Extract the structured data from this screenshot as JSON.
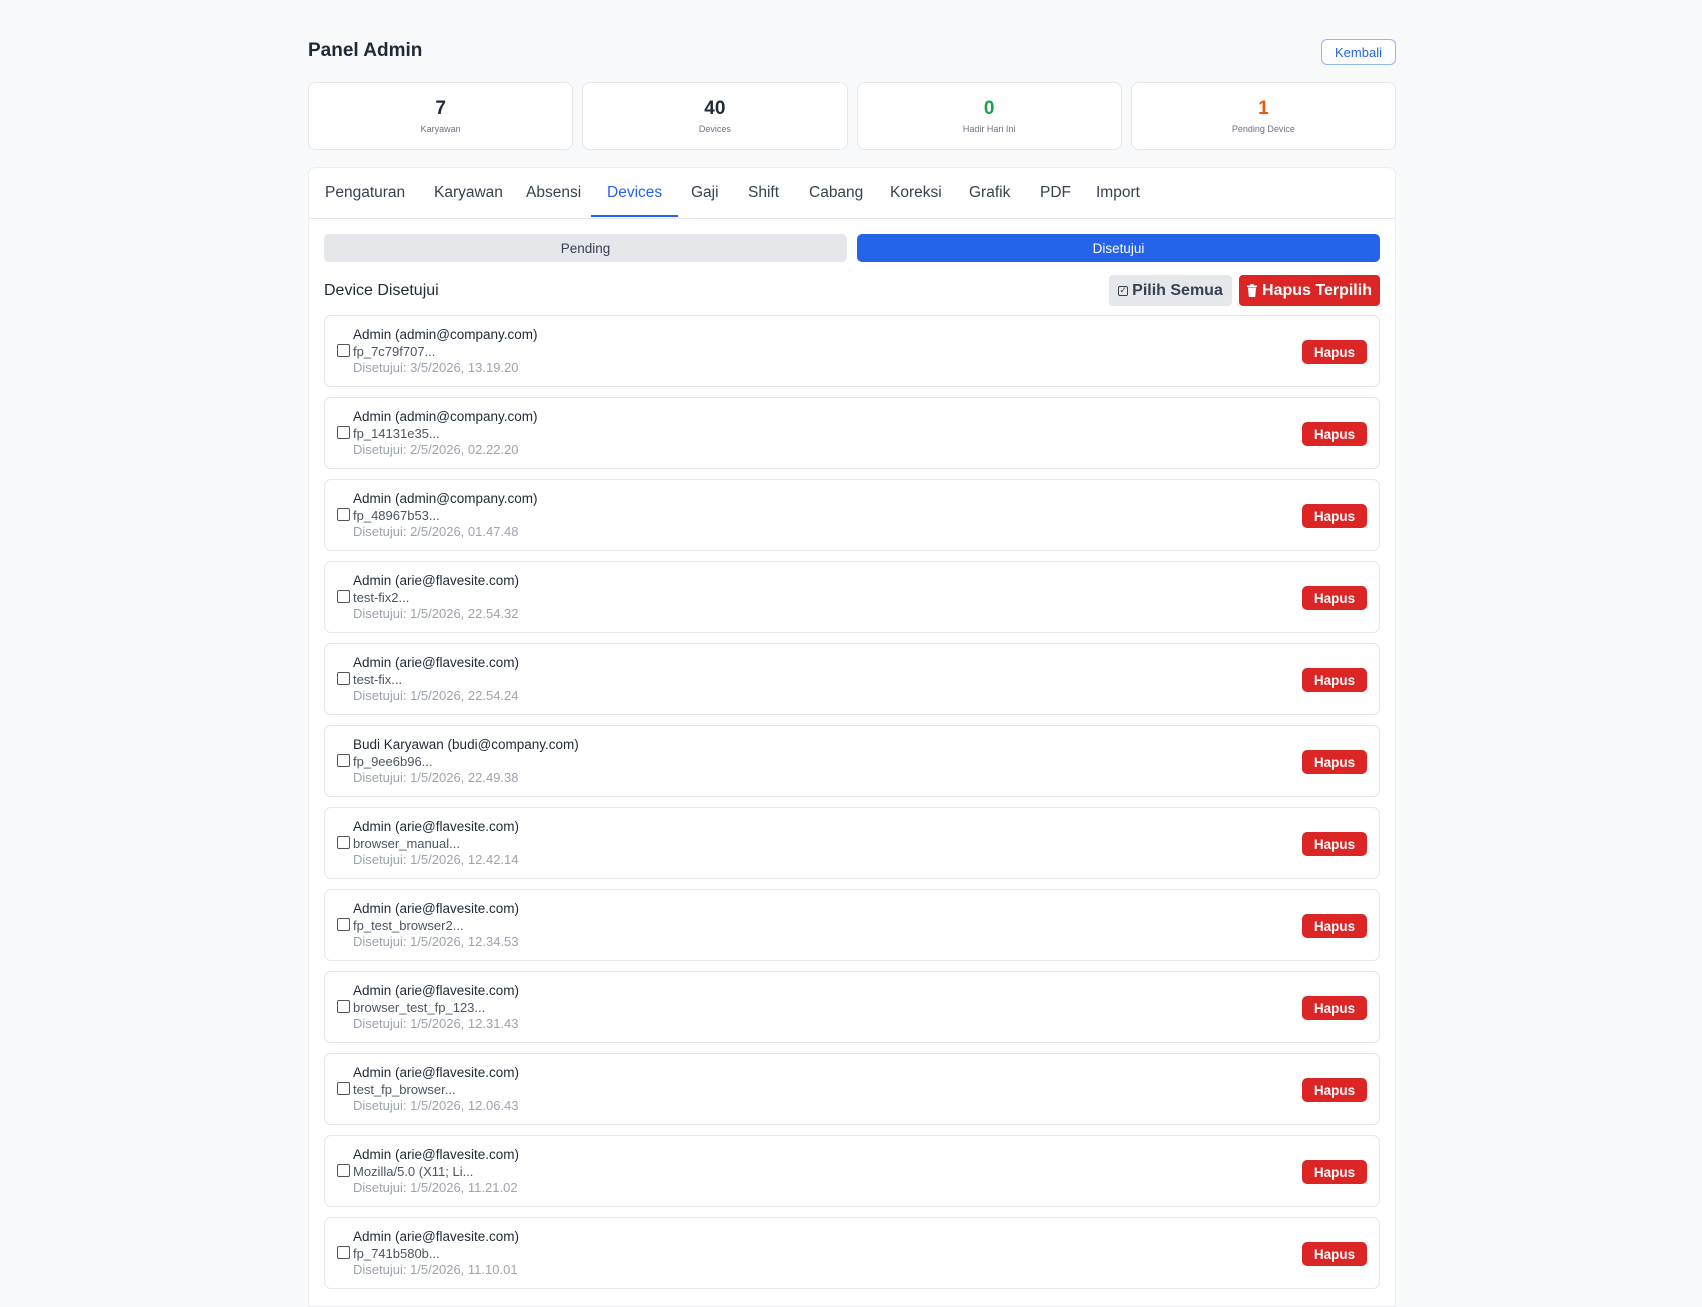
{
  "header": {
    "title": "Panel Admin",
    "back_label": "Kembali"
  },
  "stats": [
    {
      "value": "7",
      "label": "Karyawan",
      "color": "#1f2937"
    },
    {
      "value": "40",
      "label": "Devices",
      "color": "#1f2937"
    },
    {
      "value": "0",
      "label": "Hadir Hari Ini",
      "color": "#16a34a"
    },
    {
      "value": "1",
      "label": "Pending Device",
      "color": "#ea580c"
    }
  ],
  "tabs": [
    {
      "label": "Pengaturan"
    },
    {
      "label": "Karyawan"
    },
    {
      "label": "Absensi"
    },
    {
      "label": "Devices",
      "active": true
    },
    {
      "label": "Gaji"
    },
    {
      "label": "Shift"
    },
    {
      "label": "Cabang"
    },
    {
      "label": "Koreksi"
    },
    {
      "label": "Grafik"
    },
    {
      "label": "PDF"
    },
    {
      "label": "Import"
    }
  ],
  "segment": {
    "pending_label": "Pending",
    "approved_label": "Disetujui",
    "active": "approved"
  },
  "section": {
    "title": "Device Disetujui",
    "select_all_label": "Pilih Semua",
    "delete_selected_label": "Hapus Terpilih"
  },
  "devices": [
    {
      "name": "Admin (admin@company.com)",
      "fingerprint": "fp_7c79f707...",
      "approved": "Disetujui: 3/5/2026, 13.19.20",
      "delete_label": "Hapus"
    },
    {
      "name": "Admin (admin@company.com)",
      "fingerprint": "fp_14131e35...",
      "approved": "Disetujui: 2/5/2026, 02.22.20",
      "delete_label": "Hapus"
    },
    {
      "name": "Admin (admin@company.com)",
      "fingerprint": "fp_48967b53...",
      "approved": "Disetujui: 2/5/2026, 01.47.48",
      "delete_label": "Hapus"
    },
    {
      "name": "Admin (arie@flavesite.com)",
      "fingerprint": "test-fix2...",
      "approved": "Disetujui: 1/5/2026, 22.54.32",
      "delete_label": "Hapus"
    },
    {
      "name": "Admin (arie@flavesite.com)",
      "fingerprint": "test-fix...",
      "approved": "Disetujui: 1/5/2026, 22.54.24",
      "delete_label": "Hapus"
    },
    {
      "name": "Budi Karyawan (budi@company.com)",
      "fingerprint": "fp_9ee6b96...",
      "approved": "Disetujui: 1/5/2026, 22.49.38",
      "delete_label": "Hapus"
    },
    {
      "name": "Admin (arie@flavesite.com)",
      "fingerprint": "browser_manual...",
      "approved": "Disetujui: 1/5/2026, 12.42.14",
      "delete_label": "Hapus"
    },
    {
      "name": "Admin (arie@flavesite.com)",
      "fingerprint": "fp_test_browser2...",
      "approved": "Disetujui: 1/5/2026, 12.34.53",
      "delete_label": "Hapus"
    },
    {
      "name": "Admin (arie@flavesite.com)",
      "fingerprint": "browser_test_fp_123...",
      "approved": "Disetujui: 1/5/2026, 12.31.43",
      "delete_label": "Hapus"
    },
    {
      "name": "Admin (arie@flavesite.com)",
      "fingerprint": "test_fp_browser...",
      "approved": "Disetujui: 1/5/2026, 12.06.43",
      "delete_label": "Hapus"
    },
    {
      "name": "Admin (arie@flavesite.com)",
      "fingerprint": "Mozilla/5.0 (X11; Li...",
      "approved": "Disetujui: 1/5/2026, 11.21.02",
      "delete_label": "Hapus"
    },
    {
      "name": "Admin (arie@flavesite.com)",
      "fingerprint": "fp_741b580b...",
      "approved": "Disetujui: 1/5/2026, 11.10.01",
      "delete_label": "Hapus"
    }
  ]
}
